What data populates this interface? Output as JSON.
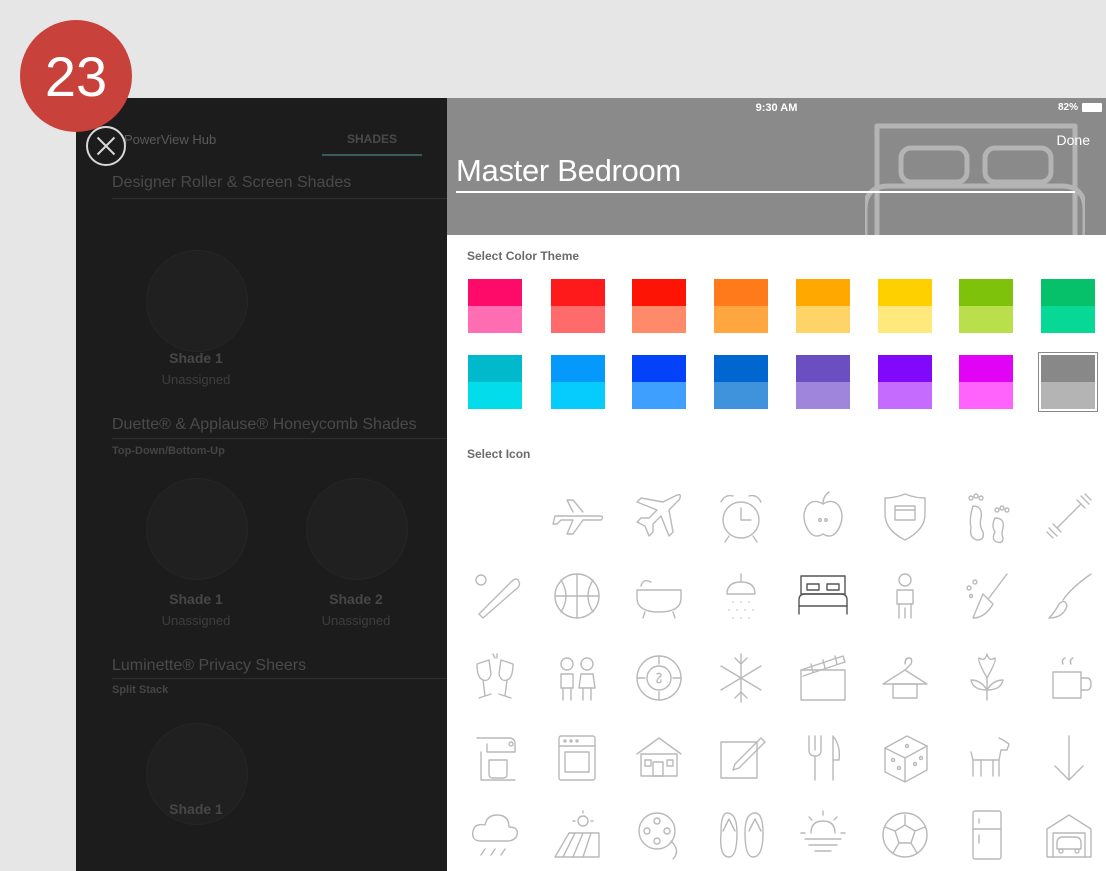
{
  "step_badge": "23",
  "left_panel": {
    "hub_title": "PowerView Hub",
    "tab_label": "SHADES",
    "sections": [
      {
        "title": "Designer Roller & Screen Shades",
        "subtitle": "",
        "shades": [
          {
            "name": "Shade 1",
            "status": "Unassigned"
          }
        ]
      },
      {
        "title": "Duette® & Applause® Honeycomb Shades",
        "subtitle": "Top-Down/Bottom-Up",
        "shades": [
          {
            "name": "Shade 1",
            "status": "Unassigned"
          },
          {
            "name": "Shade 2",
            "status": "Unassigned"
          }
        ]
      },
      {
        "title": "Luminette® Privacy Sheers",
        "subtitle": "Split Stack",
        "shades": [
          {
            "name": "Shade 1",
            "status": ""
          }
        ]
      }
    ]
  },
  "editor": {
    "status_time": "9:30 AM",
    "battery": "82%",
    "done_label": "Done",
    "room_name": "Master Bedroom",
    "color_theme_label": "Select Color Theme",
    "icon_label": "Select Icon",
    "header_color": "#8a8a8a",
    "color_themes": [
      {
        "top": "#fe0b69",
        "bottom": "#ff6db3"
      },
      {
        "top": "#fe1a1a",
        "bottom": "#ff6b6b"
      },
      {
        "top": "#fe1405",
        "bottom": "#ff8a6a"
      },
      {
        "top": "#ff7a1a",
        "bottom": "#ffa640"
      },
      {
        "top": "#ffa800",
        "bottom": "#ffd466"
      },
      {
        "top": "#ffd000",
        "bottom": "#ffe97d"
      },
      {
        "top": "#7fc20c",
        "bottom": "#b9e04c"
      },
      {
        "top": "#06c16a",
        "bottom": "#08d896"
      },
      {
        "top": "#00b9cd",
        "bottom": "#03ddeb"
      },
      {
        "top": "#0499fb",
        "bottom": "#06ccfe"
      },
      {
        "top": "#0442f9",
        "bottom": "#3e9fff"
      },
      {
        "top": "#0067d0",
        "bottom": "#3e93dc"
      },
      {
        "top": "#6b4fc2",
        "bottom": "#a086da"
      },
      {
        "top": "#8208fb",
        "bottom": "#c56cff"
      },
      {
        "top": "#e003f6",
        "bottom": "#ff63fb"
      },
      {
        "top": "#888888",
        "bottom": "#b4b4b4",
        "selected": true
      }
    ],
    "icons": [
      [
        "blank-icon",
        "airplane-outline-icon",
        "airplane-icon",
        "alarm-clock-icon",
        "apple-icon",
        "shield-icon",
        "footprints-icon",
        "dumbbell-icon"
      ],
      [
        "baseball-bat-icon",
        "basketball-icon",
        "bathtub-icon",
        "shower-icon",
        "bed-icon",
        "child-icon",
        "broom-icon",
        "paintbrush-icon"
      ],
      [
        "champagne-toast-icon",
        "kids-icon",
        "poker-chip-icon",
        "snowflake-icon",
        "clapperboard-icon",
        "coat-hanger-icon",
        "flower-icon",
        "coffee-mug-icon"
      ],
      [
        "stand-mixer-icon",
        "oven-icon",
        "house-icon",
        "edit-note-icon",
        "fork-knife-icon",
        "dice-icon",
        "dog-icon",
        "down-arrow-icon"
      ],
      [
        "rain-cloud-icon",
        "farm-field-icon",
        "film-reel-icon",
        "flip-flops-icon",
        "sunrise-icon",
        "soccer-ball-icon",
        "refrigerator-icon",
        "garage-icon"
      ]
    ],
    "selected_icon": "bed-icon"
  }
}
